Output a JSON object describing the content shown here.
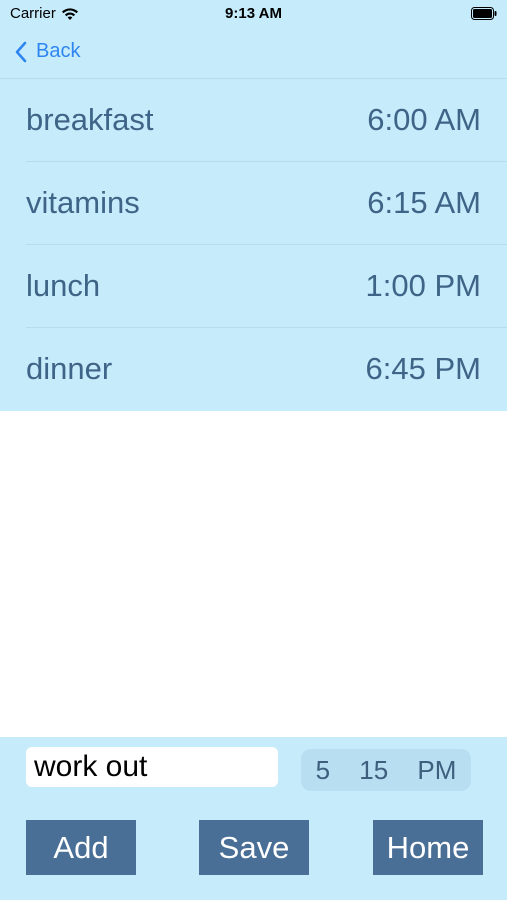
{
  "status_bar": {
    "carrier": "Carrier",
    "time": "9:13 AM"
  },
  "nav": {
    "back_label": "Back"
  },
  "schedule": [
    {
      "name": "breakfast",
      "time": "6:00 AM"
    },
    {
      "name": "vitamins",
      "time": "6:15 AM"
    },
    {
      "name": "lunch",
      "time": "1:00 PM"
    },
    {
      "name": "dinner",
      "time": "6:45 PM"
    }
  ],
  "form": {
    "name_value": "work out",
    "time_picker": {
      "hour": "5",
      "minute": "15",
      "period": "PM"
    }
  },
  "buttons": {
    "add": "Add",
    "save": "Save",
    "home": "Home"
  },
  "icons": {
    "wifi": "wifi-icon",
    "battery": "battery-icon",
    "back": "chevron-left-icon"
  },
  "colors": {
    "panel_bg": "#c6ebfb",
    "row_text": "#3e6487",
    "link_blue": "#2f86f0",
    "button_bg": "#4a6f96"
  }
}
